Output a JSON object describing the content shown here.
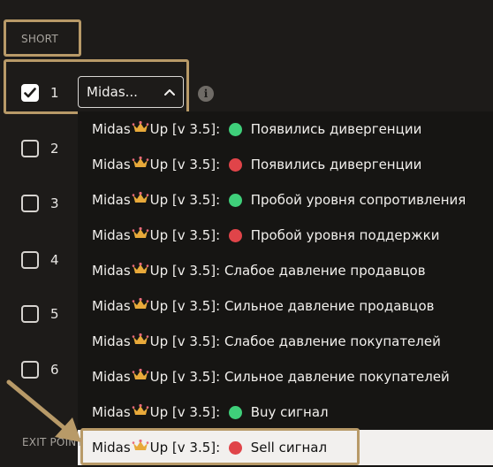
{
  "section_label": "SHORT",
  "exit_label": "EXIT POINT",
  "checkbox_rows": [
    {
      "num": "1",
      "checked": true
    },
    {
      "num": "2",
      "checked": false
    },
    {
      "num": "3",
      "checked": false
    },
    {
      "num": "4",
      "checked": false
    },
    {
      "num": "5",
      "checked": false
    },
    {
      "num": "6",
      "checked": false
    }
  ],
  "select": {
    "value": "Midas..."
  },
  "info_icon": "i",
  "options": [
    {
      "prefix": "Midas",
      "suffix": "Up [v 3.5]:",
      "dot": "green",
      "text": "Появились дивергенции"
    },
    {
      "prefix": "Midas",
      "suffix": "Up [v 3.5]:",
      "dot": "red",
      "text": "Появились дивергенции"
    },
    {
      "prefix": "Midas",
      "suffix": "Up [v 3.5]:",
      "dot": "green",
      "text": "Пробой уровня сопротивления"
    },
    {
      "prefix": "Midas",
      "suffix": "Up [v 3.5]:",
      "dot": "red",
      "text": "Пробой уровня поддержки"
    },
    {
      "prefix": "Midas",
      "suffix": "Up [v 3.5]:",
      "dot": "",
      "text": "Слабое давление продавцов"
    },
    {
      "prefix": "Midas",
      "suffix": "Up [v 3.5]:",
      "dot": "",
      "text": "Сильное давление продавцов"
    },
    {
      "prefix": "Midas",
      "suffix": "Up [v 3.5]:",
      "dot": "",
      "text": "Слабое давление покупателей"
    },
    {
      "prefix": "Midas",
      "suffix": "Up [v 3.5]:",
      "dot": "",
      "text": "Сильное давление покупателей"
    },
    {
      "prefix": "Midas",
      "suffix": "Up [v 3.5]:",
      "dot": "green",
      "text": "Buy сигнал"
    },
    {
      "prefix": "Midas",
      "suffix": "Up [v 3.5]:",
      "dot": "red",
      "text": "Sell сигнал"
    }
  ],
  "colors": {
    "highlight": "#b89a68",
    "green": "#3fcf7a",
    "red": "#e04449",
    "background": "#1d1b19"
  }
}
